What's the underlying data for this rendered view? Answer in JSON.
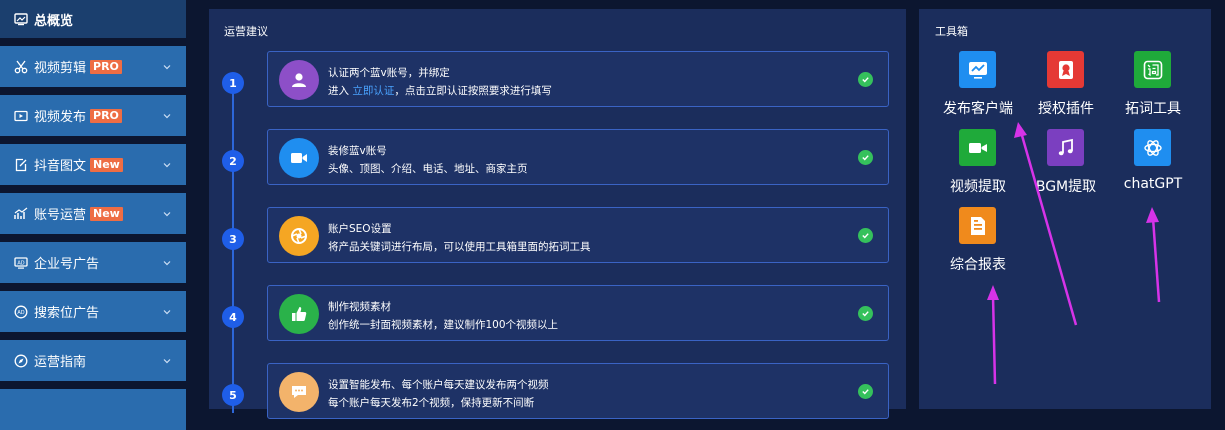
{
  "sidebar": {
    "items": [
      {
        "label": "总概览",
        "icon": "dashboard-icon",
        "badge": "",
        "active": true
      },
      {
        "label": "视频剪辑",
        "icon": "scissors-icon",
        "badge": "PRO"
      },
      {
        "label": "视频发布",
        "icon": "video-publish-icon",
        "badge": "PRO"
      },
      {
        "label": "抖音图文",
        "icon": "edit-icon",
        "badge": "New"
      },
      {
        "label": "账号运营",
        "icon": "chart-icon",
        "badge": "New"
      },
      {
        "label": "企业号广告",
        "icon": "ad-icon",
        "badge": ""
      },
      {
        "label": "搜索位广告",
        "icon": "search-ad-icon",
        "badge": ""
      },
      {
        "label": "运营指南",
        "icon": "compass-icon",
        "badge": ""
      }
    ]
  },
  "main": {
    "title": "运营建议",
    "steps": [
      {
        "num": "1",
        "title": "认证两个蓝v账号，并绑定",
        "desc_pre": "进入 ",
        "desc_link": "立即认证",
        "desc_post": "，点击立即认证按照要求进行填写",
        "icon": "user-icon",
        "color": "#8d4fc8"
      },
      {
        "num": "2",
        "title": "装修蓝v账号",
        "desc_pre": "头像、顶图、介绍、电话、地址、商家主页",
        "desc_link": "",
        "desc_post": "",
        "icon": "video-camera-icon",
        "color": "#1f8ef0"
      },
      {
        "num": "3",
        "title": "账户SEO设置",
        "desc_pre": "将产品关键词进行布局，可以使用工具箱里面的拓词工具",
        "desc_link": "",
        "desc_post": "",
        "icon": "aperture-icon",
        "color": "#f5a623"
      },
      {
        "num": "4",
        "title": "制作视频素材",
        "desc_pre": "创作统一封面视频素材，建议制作100个视频以上",
        "desc_link": "",
        "desc_post": "",
        "icon": "thumbs-up-icon",
        "color": "#2ab24a"
      },
      {
        "num": "5",
        "title": "设置智能发布、每个账户每天建议发布两个视频",
        "desc_pre": "每个账户每天发布2个视频，保持更新不间断",
        "desc_link": "",
        "desc_post": "",
        "icon": "chat-icon",
        "color": "#f3b36b"
      }
    ]
  },
  "toolbox": {
    "title": "工具箱",
    "tools": [
      {
        "label": "发布客户端",
        "icon": "monitor-chart-icon",
        "color": "#1f8ef0"
      },
      {
        "label": "授权插件",
        "icon": "license-icon",
        "color": "#e53935"
      },
      {
        "label": "拓词工具",
        "icon": "ci-icon",
        "color": "#1faa3a"
      },
      {
        "label": "视频提取",
        "icon": "video-camera-icon",
        "color": "#1faa3a"
      },
      {
        "label": "BGM提取",
        "icon": "music-icon",
        "color": "#7b3fc0"
      },
      {
        "label": "chatGPT",
        "icon": "openai-icon",
        "color": "#1f8ef0"
      },
      {
        "label": "综合报表",
        "icon": "report-icon",
        "color": "#f08a1c"
      }
    ]
  },
  "colors": {
    "accent": "#2d66d8",
    "sidebar": "#2a6cae",
    "badge": "#ee6d44",
    "check": "#35c15c",
    "annotation_arrow": "#d633e8"
  }
}
